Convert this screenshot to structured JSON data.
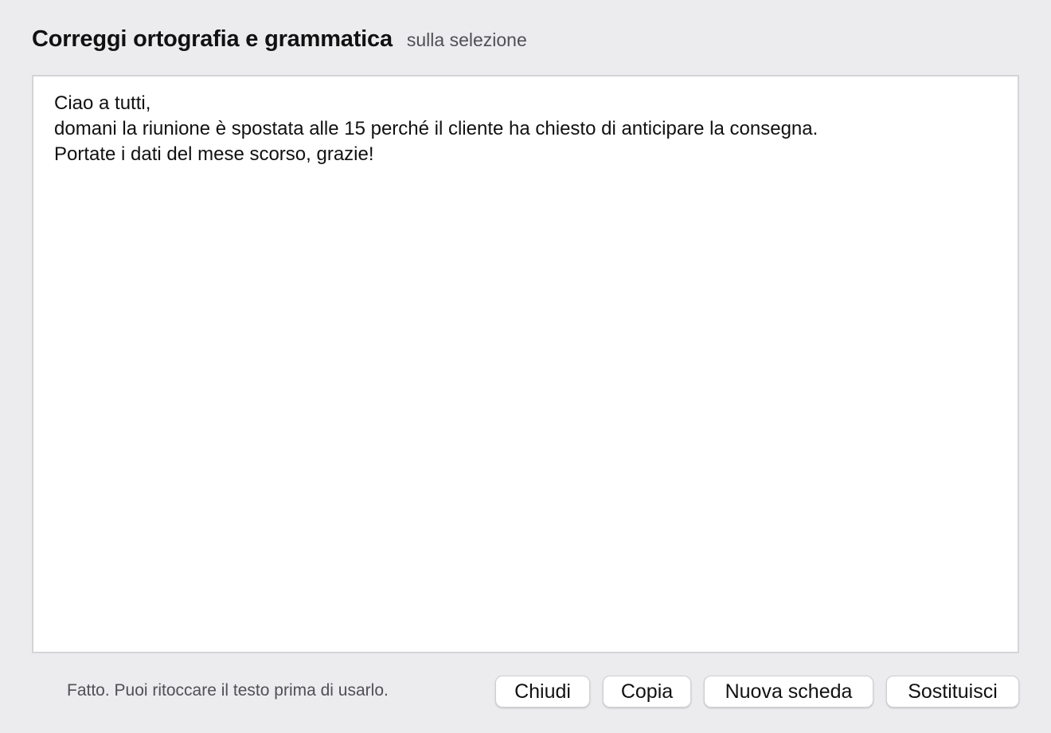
{
  "header": {
    "title": "Correggi ortografia e grammatica",
    "subtitle": "sulla selezione"
  },
  "editor": {
    "lines": [
      "Ciao a tutti,",
      "domani la riunione è spostata alle 15 perché il cliente ha chiesto di anticipare la consegna.",
      "Portate i dati del mese scorso, grazie!"
    ]
  },
  "footer": {
    "status": "Fatto. Puoi ritoccare il testo prima di usarlo.",
    "buttons": {
      "close": "Chiudi",
      "copy": "Copia",
      "new_tab": "Nuova scheda",
      "replace": "Sostituisci"
    }
  },
  "colors": {
    "background": "#ececee",
    "editor_background": "#ffffff",
    "editor_border": "#d4d4d8",
    "text": "#111111",
    "muted_text": "#505055"
  }
}
